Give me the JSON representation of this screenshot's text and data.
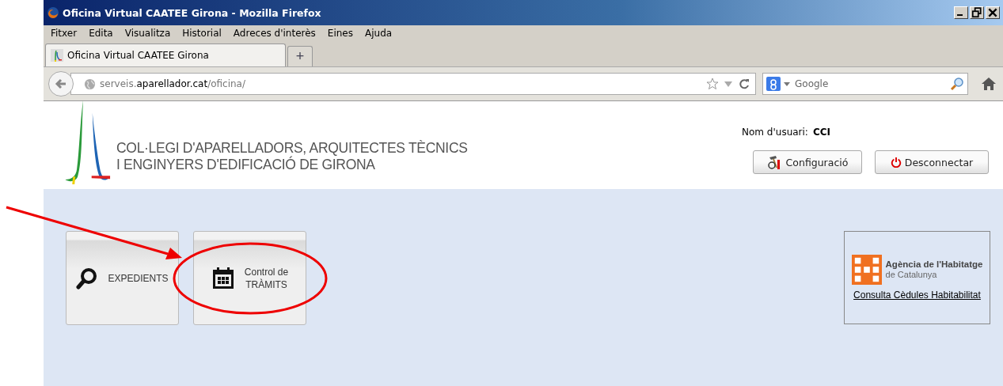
{
  "window": {
    "title": "Oficina Virtual CAATEE Girona - Mozilla Firefox"
  },
  "menu": [
    "Fitxer",
    "Edita",
    "Visualitza",
    "Historial",
    "Adreces d'interès",
    "Eines",
    "Ajuda"
  ],
  "tabs": [
    {
      "label": "Oficina Virtual CAATEE Girona",
      "selected": true
    }
  ],
  "new_tab": "+",
  "address": {
    "host_prefix": "serveis.",
    "domain": "aparellador.cat",
    "path": "/oficina/"
  },
  "search": {
    "placeholder": "Google"
  },
  "header": {
    "org_line_1": "COL·LEGI D'APARELLADORS, ARQUITECTES TÈCNICS",
    "org_line_2": "I ENGINYERS D'EDIFICACIÓ DE GIRONA",
    "user_label": "Nom d'usuari:",
    "user_name": "CCI",
    "buttons": [
      {
        "kind": "config",
        "label": "Configuració"
      },
      {
        "kind": "logout",
        "label": "Desconnectar"
      }
    ]
  },
  "tiles": [
    {
      "kind": "search",
      "lines": [
        "EXPEDIENTS"
      ]
    },
    {
      "kind": "calendar",
      "lines": [
        "Control de",
        "TRÀMITS"
      ]
    }
  ],
  "agency": {
    "name": "Agència de l'Habitatge",
    "region": "de Catalunya",
    "link": "Consulta Cèdules Habitabilitat"
  },
  "annotations": {
    "arrow": true,
    "ellipse": true
  }
}
